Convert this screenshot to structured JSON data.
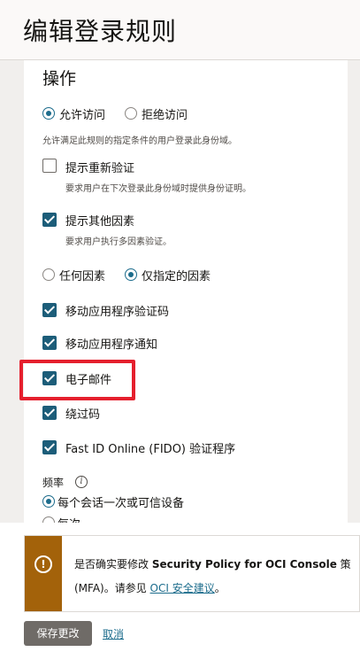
{
  "header": {
    "title": "编辑登录规则"
  },
  "action": {
    "title": "操作",
    "allow_label": "允许访问",
    "deny_label": "拒绝访问",
    "allow_hint": "允许满足此规则的指定条件的用户登录此身份域。"
  },
  "reauth": {
    "label": "提示重新验证",
    "hint": "要求用户在下次登录此身份域时提供身份证明。"
  },
  "other_factors": {
    "label": "提示其他因素",
    "hint": "要求用户执行多因素验证。"
  },
  "factor_mode": {
    "any_label": "任何因素",
    "specified_label": "仅指定的因素"
  },
  "factors": [
    {
      "label": "移动应用程序验证码",
      "checked": true
    },
    {
      "label": "移动应用程序通知",
      "checked": true
    },
    {
      "label": "电子邮件",
      "checked": true
    },
    {
      "label": "绕过码",
      "checked": true
    },
    {
      "label": "Fast ID Online (FIDO) 验证程序",
      "checked": true
    }
  ],
  "frequency": {
    "label": "频率",
    "option1": "每个会话一次或可信设备",
    "option2": "每次"
  },
  "warning": {
    "text_before": "是否确实要修改 ",
    "policy_name": "Security Policy for OCI Console",
    "text_after": " 策",
    "line2_before": "(MFA)。请参见 ",
    "link": "OCI 安全建议",
    "line2_after": "。"
  },
  "footer": {
    "save_label": "保存更改",
    "cancel_label": "取消"
  },
  "colors": {
    "accent": "#1c6c8c",
    "checkbox": "#1c5d79",
    "warning": "#a3620a",
    "highlight": "#e51f2d"
  }
}
